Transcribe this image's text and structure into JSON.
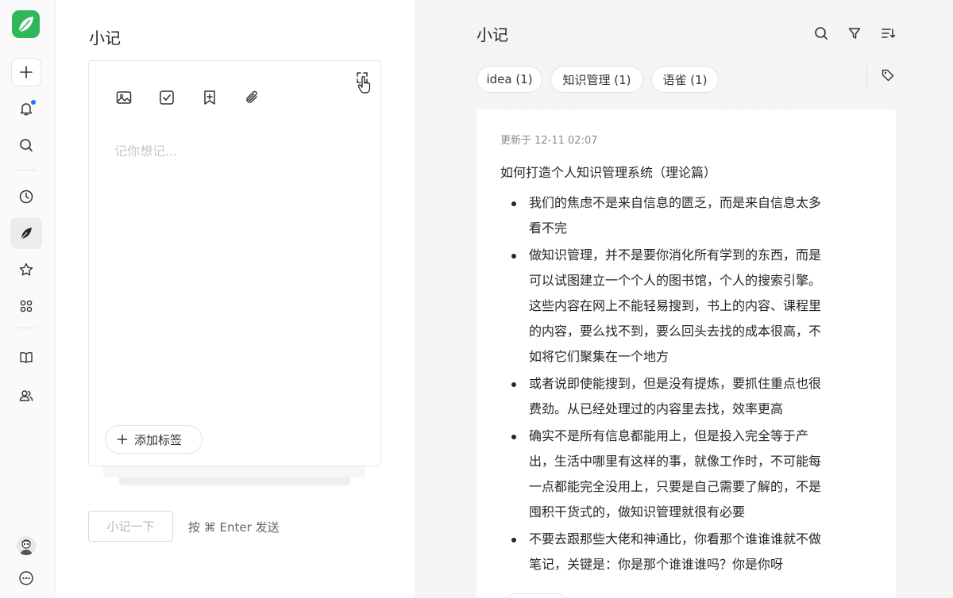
{
  "app": {
    "brand_color": "#2fb85a",
    "accent_color": "#1677ff"
  },
  "rail": {
    "icons": [
      "logo-icon",
      "plus-icon",
      "bell-icon",
      "search-icon",
      "clock-icon",
      "feather-icon",
      "star-icon",
      "apps-icon",
      "book-icon",
      "users-icon",
      "avatar",
      "more-icon"
    ],
    "has_notification": true
  },
  "editor": {
    "title": "小记",
    "placeholder": "记你想记...",
    "add_tag_label": "添加标签",
    "send_label": "小记一下",
    "send_hint": "按 ⌘ Enter 发送"
  },
  "list": {
    "title": "小记",
    "tags": [
      {
        "label": "idea (1)"
      },
      {
        "label": "知识管理 (1)"
      },
      {
        "label": "语雀 (1)"
      }
    ],
    "note": {
      "updated": "更新于 12-11 02:07",
      "title": "如何打造个人知识管理系统（理论篇）",
      "items": [
        [
          "我们的焦虑不是来自信息的匮乏，而是来自信息太多",
          "看不完"
        ],
        [
          "做知识管理，并不是要你消化所有学到的东西，而是",
          "可以试图建立一个个人的图书馆，个人的搜索引擎。",
          "这些内容在网上不能轻易搜到，书上的内容、课程里",
          "的内容，要么找不到，要么回头去找的成本很高，不",
          "如将它们聚集在一个地方"
        ],
        [
          "或者说即使能搜到，但是没有提炼，要抓住重点也很",
          "费劲。从已经处理过的内容里去找，效率更高"
        ],
        [
          "确实不是所有信息都能用上，但是投入完全等于产",
          "出，生活中哪里有这样的事，就像工作时，不可能每",
          "一点都能完全没用上，只要是自己需要了解的，不是",
          "囤积干货式的，做知识管理就很有必要"
        ],
        [
          "不要去跟那些大佬和神通比，你看那个谁谁谁就不做",
          "笔记，关键是：你是那个谁谁谁吗？你是你呀"
        ]
      ]
    }
  }
}
